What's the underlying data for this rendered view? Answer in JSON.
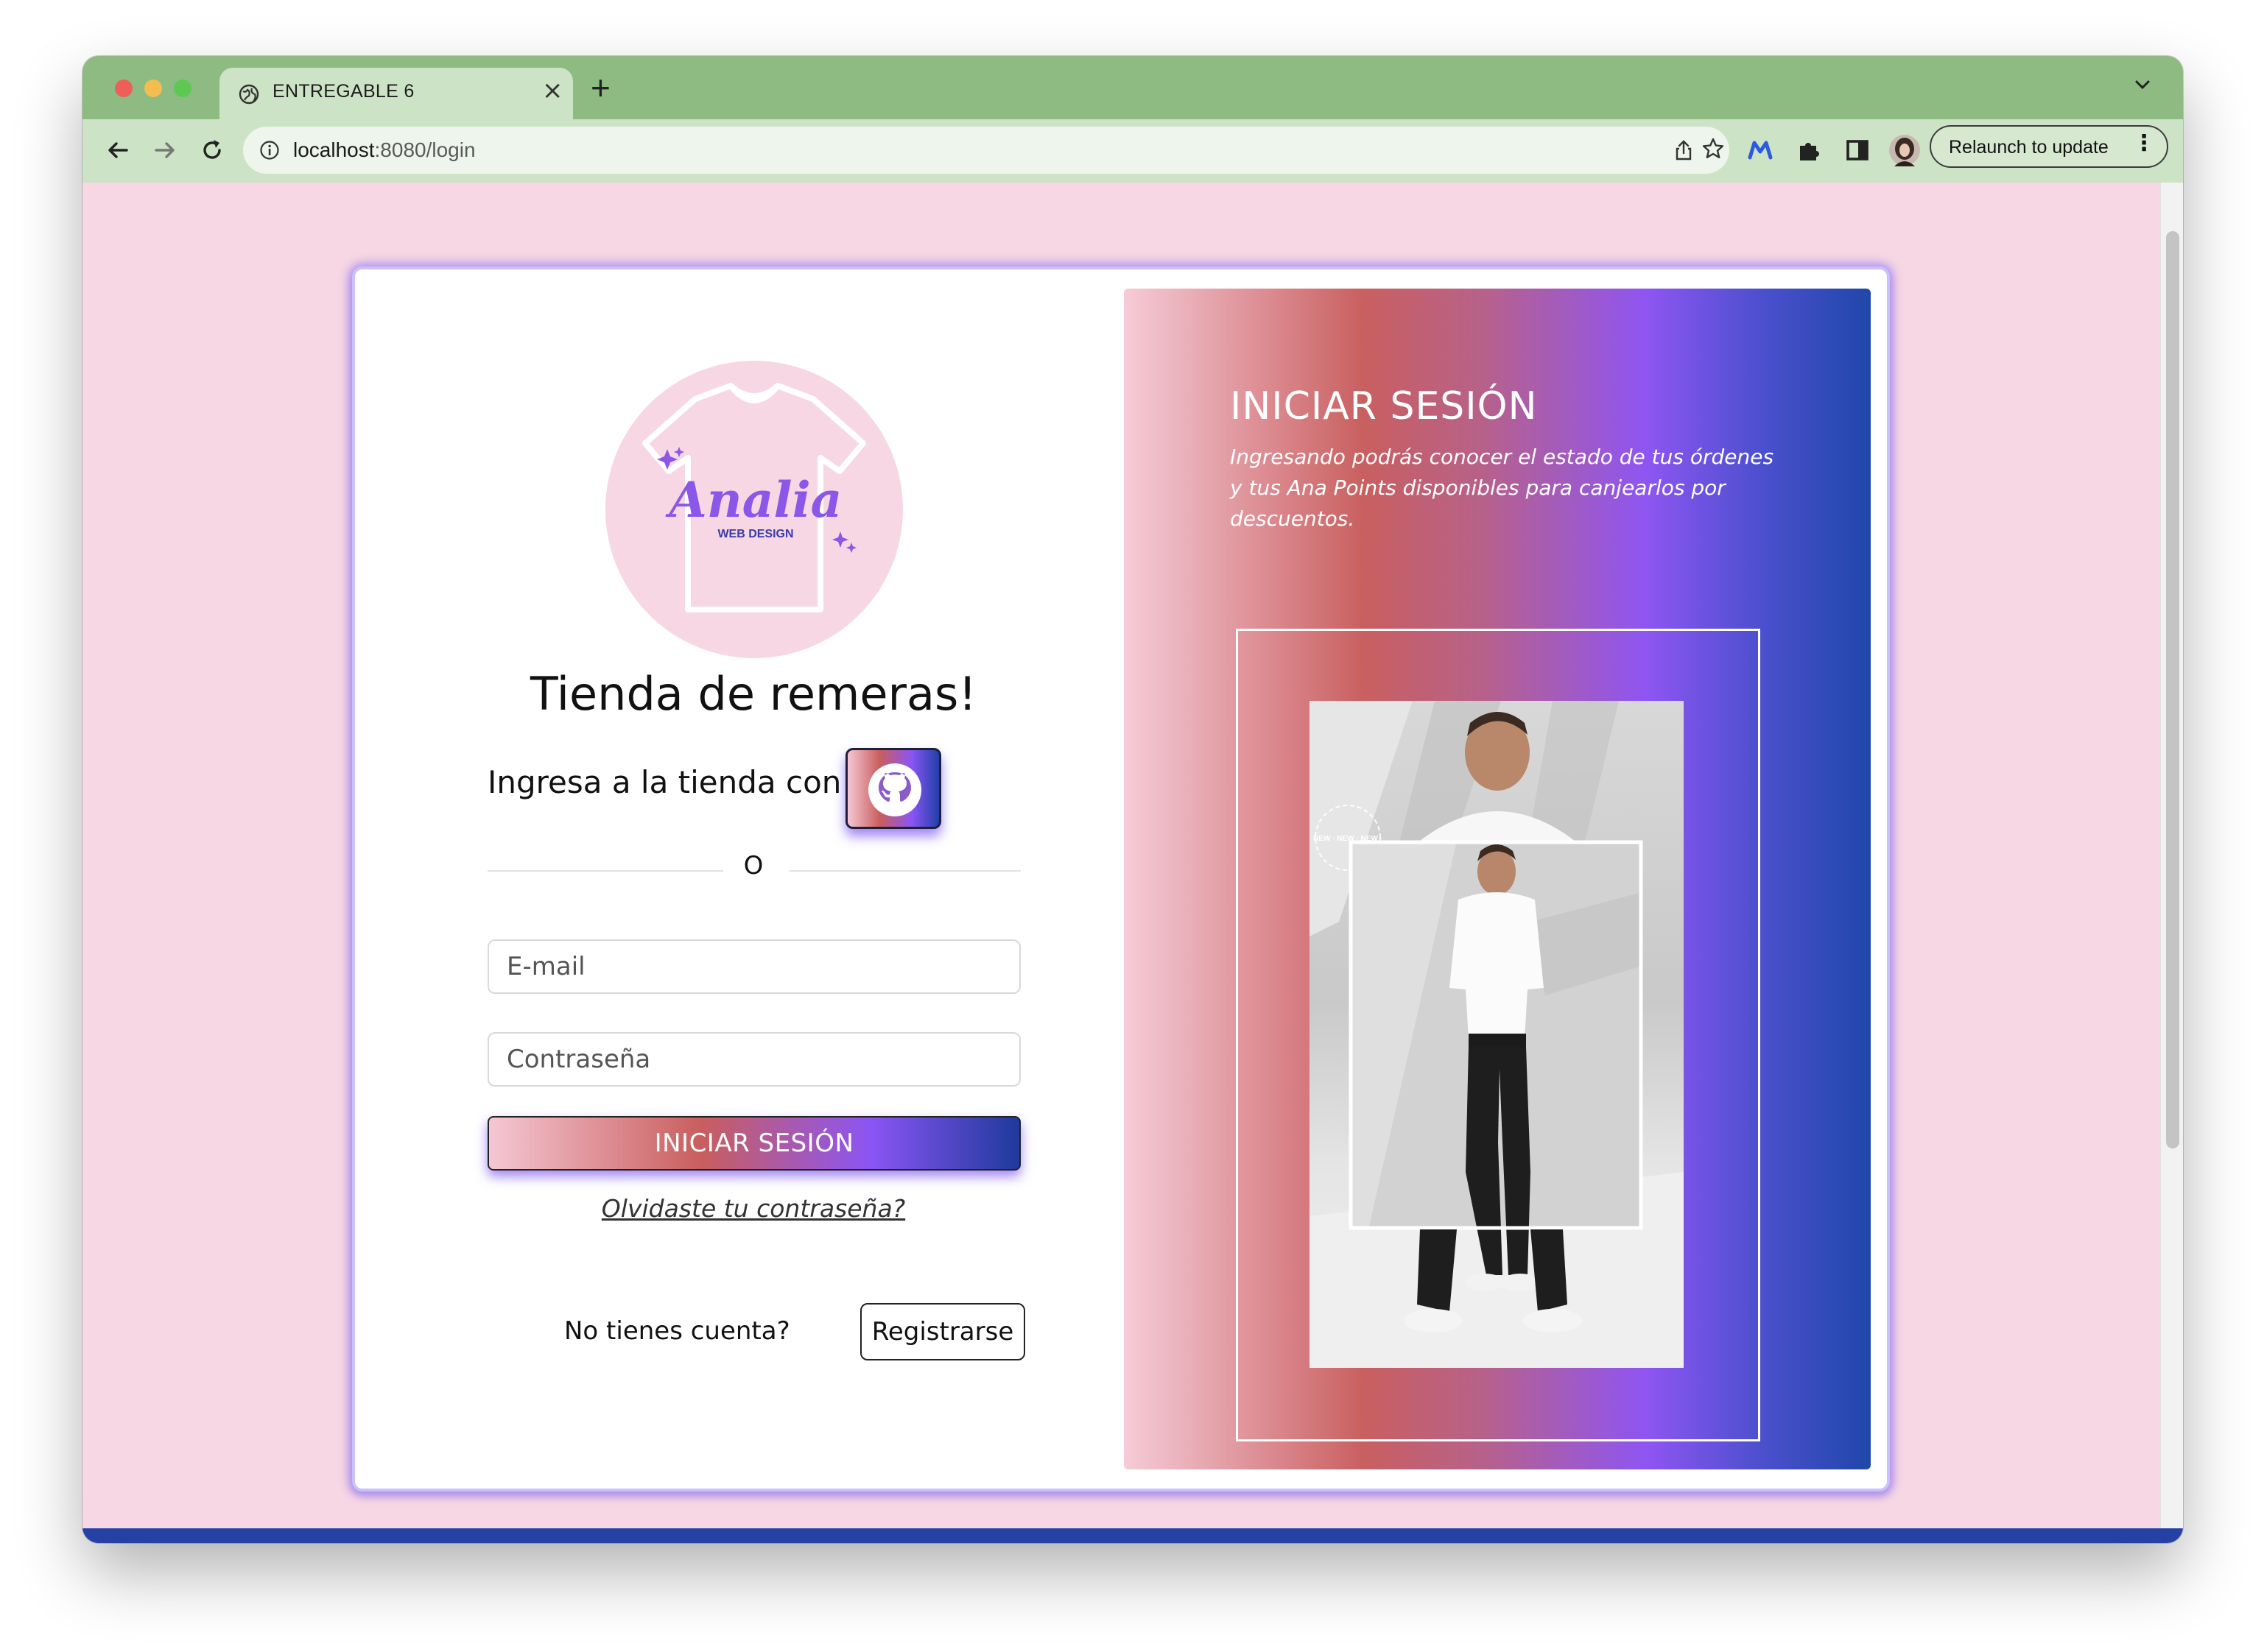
{
  "browser": {
    "tab_title": "ENTREGABLE 6",
    "url_host": "localhost",
    "url_path": ":8080/login",
    "relaunch_label": "Relaunch to update",
    "new_tab_symbol": "+",
    "close_symbol": "×",
    "menu_symbol": "⋮"
  },
  "left": {
    "logo_text": "Analia",
    "logo_subtext": "WEB DESIGN",
    "store_title": "Tienda de remeras!",
    "github_prompt": "Ingresa a la tienda con",
    "divider": "O",
    "email_placeholder": "E-mail",
    "password_placeholder": "Contraseña",
    "login_button": "INICIAR SESIÓN",
    "forgot_link": "Olvidaste tu contraseña?",
    "no_account": "No tienes cuenta?",
    "register_button": "Registrarse"
  },
  "right": {
    "title": "INICIAR SESIÓN",
    "description": "Ingresando podrás conocer el estado de tus órdenes y tus Ana Points disponibles para canjearlos por descuentos.",
    "badge_text": "NEW · NEW · NEW ·"
  },
  "colors": {
    "page_bg": "#f7d7e3",
    "gradient": [
      "#f5ccd8",
      "#c96060",
      "#8e55f2",
      "#1f47a9"
    ],
    "browser_chrome": "#8dbb82",
    "accent_glow": "#a98cf0"
  },
  "icons": [
    "globe-icon",
    "close-icon",
    "plus-icon",
    "chevron-down-icon",
    "back-icon",
    "forward-icon",
    "reload-icon",
    "info-icon",
    "share-icon",
    "star-icon",
    "extension-m-icon",
    "puzzle-icon",
    "sidebar-icon",
    "avatar",
    "github-icon",
    "tshirt-logo"
  ]
}
